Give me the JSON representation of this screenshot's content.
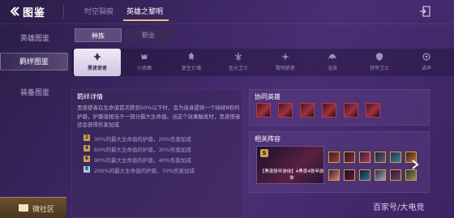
{
  "header": {
    "title": "图鉴",
    "tabs": [
      "时空裂痕",
      "英雄之黎明"
    ],
    "active_tab": "英雄之黎明"
  },
  "sidebar": {
    "items": [
      {
        "label": "英雄图鉴"
      },
      {
        "label": "羁绊图鉴",
        "selected": true
      },
      {
        "label": "装备图鉴"
      }
    ],
    "community_label": "微社区"
  },
  "subtabs": [
    "种族",
    "职业"
  ],
  "categories": [
    {
      "label": "黑夜使者",
      "icon": "dark-emblem-icon",
      "selected": true
    },
    {
      "label": "小恶魔",
      "icon": "imp-icon"
    },
    {
      "label": "复生亡魂",
      "icon": "revenant-icon"
    },
    {
      "label": "圣光卫士",
      "icon": "light-guard-icon"
    },
    {
      "label": "黎明使者",
      "icon": "dawn-emblem-icon"
    },
    {
      "label": "龙族",
      "icon": "dragon-icon"
    },
    {
      "label": "铁甲卫士",
      "icon": "iron-guard-icon"
    },
    {
      "label": "讲声",
      "icon": "voice-icon"
    }
  ],
  "detail": {
    "title": "羁绊详情",
    "description": "黑夜使者在生命值首次跌到50%以下时，会为自身提供一个持续8秒的护盾，护盾值相当于一部分最大生命值。当这个效果触发时，黑夜使者还会获得伤害加成",
    "tiers": [
      {
        "count": "2",
        "text": "30%的最大生命值的护盾，20%伤害加成",
        "color": "#c9a34a"
      },
      {
        "count": "4",
        "text": "60%的最大生命值的护盾，30%伤害加成",
        "color": "#c9a34a"
      },
      {
        "count": "6",
        "text": "90%的最大生命值的护盾，40%伤害加成",
        "color": "#c9a34a"
      },
      {
        "count": "8",
        "text": "200%的最大生命值的护盾，70%伤害加成",
        "color": "#9ad7e6"
      }
    ]
  },
  "coop": {
    "title": "协同英雄",
    "hero_count": 6
  },
  "lineup": {
    "title": "相关阵容",
    "badge": "S",
    "label": "【黑夜铁甲游侠】4黑夜4铁甲游侠",
    "mini_count": 12
  },
  "watermark": "百家号/大电竞",
  "colors": {
    "accent_gold": "#e5c07b",
    "background": "#3a2560"
  }
}
